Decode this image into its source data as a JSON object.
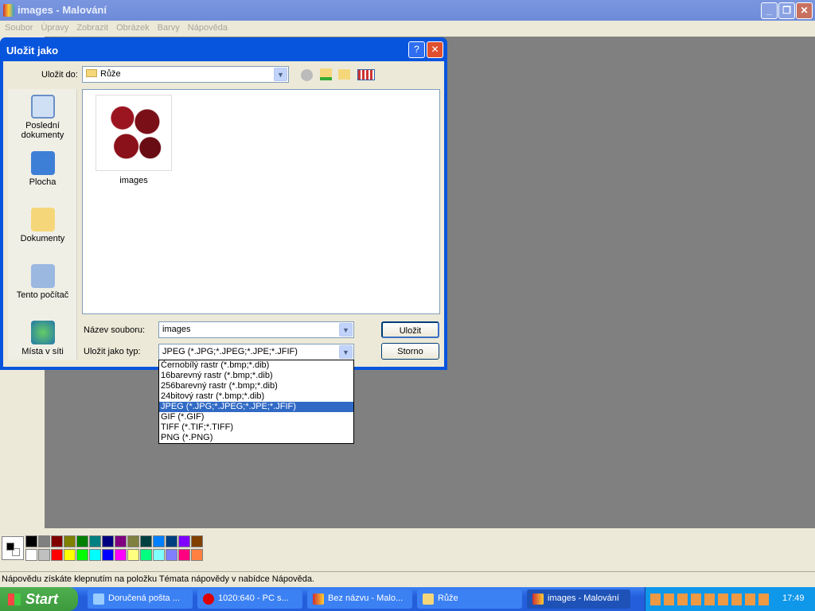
{
  "window": {
    "title": "images - Malování"
  },
  "menu": [
    "Soubor",
    "Úpravy",
    "Zobrazit",
    "Obrázek",
    "Barvy",
    "Nápověda"
  ],
  "dialog": {
    "title": "Uložit jako",
    "save_in_label": "Uložit do:",
    "save_in_value": "Růže",
    "places": [
      "Poslední dokumenty",
      "Plocha",
      "Dokumenty",
      "Tento počítač",
      "Místa v síti"
    ],
    "files": [
      {
        "name": "images"
      }
    ],
    "filename_label": "Název souboru:",
    "filename_value": "images",
    "type_label": "Uložit jako typ:",
    "type_value": "JPEG (*.JPG;*.JPEG;*.JPE;*.JFIF)",
    "save_button": "Uložit",
    "cancel_button": "Storno",
    "type_options": [
      "Černobílý rastr (*.bmp;*.dib)",
      "16barevný rastr (*.bmp;*.dib)",
      "256barevný rastr (*.bmp;*.dib)",
      "24bitový rastr (*.bmp;*.dib)",
      "JPEG (*.JPG;*.JPEG;*.JPE;*.JFIF)",
      "GIF (*.GIF)",
      "TIFF (*.TIF;*.TIFF)",
      "PNG (*.PNG)"
    ],
    "selected_option": 4
  },
  "palette": {
    "top": [
      "#000000",
      "#808080",
      "#800000",
      "#808000",
      "#008000",
      "#008080",
      "#000080",
      "#800080",
      "#808040",
      "#004040",
      "#0080ff",
      "#004080",
      "#8000ff",
      "#804000"
    ],
    "bottom": [
      "#ffffff",
      "#c0c0c0",
      "#ff0000",
      "#ffff00",
      "#00ff00",
      "#00ffff",
      "#0000ff",
      "#ff00ff",
      "#ffff80",
      "#00ff80",
      "#80ffff",
      "#8080ff",
      "#ff0080",
      "#ff8040"
    ]
  },
  "status": "Nápovědu získáte klepnutím na položku Témata nápovědy v nabídce Nápověda.",
  "taskbar": {
    "start": "Start",
    "tasks": [
      "Doručená pošta ...",
      "1020:640 - PC s...",
      "Bez názvu - Malo...",
      "Růže",
      "images - Malování"
    ],
    "clock": "17:49"
  }
}
